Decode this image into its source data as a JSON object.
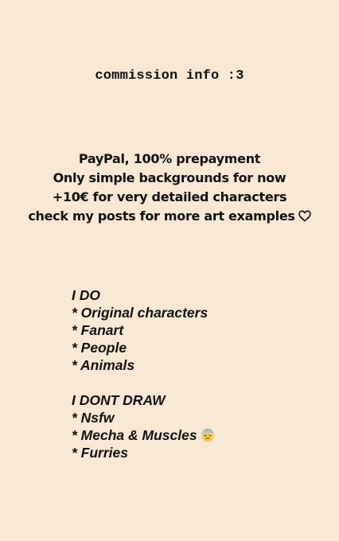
{
  "title": "commission info :3",
  "info": {
    "lines": [
      "PayPal, 100% prepayment",
      "Only simple backgrounds for now",
      "+10€ for very detailed characters",
      "check my posts for more art examples"
    ],
    "end_icon": "heart-outline-icon"
  },
  "do_list": {
    "heading": "I DO",
    "items": [
      "* Original characters",
      "* Fanart",
      "* People",
      "* Animals"
    ]
  },
  "dont_list": {
    "heading": "I DONT DRAW",
    "items": [
      "* Nsfw",
      "* Mecha & Muscles",
      "* Furries"
    ],
    "item_icon": "downcast-sweat-face-emoji-icon"
  },
  "colors": {
    "background": "#f8e8d4",
    "text": "#111111"
  }
}
